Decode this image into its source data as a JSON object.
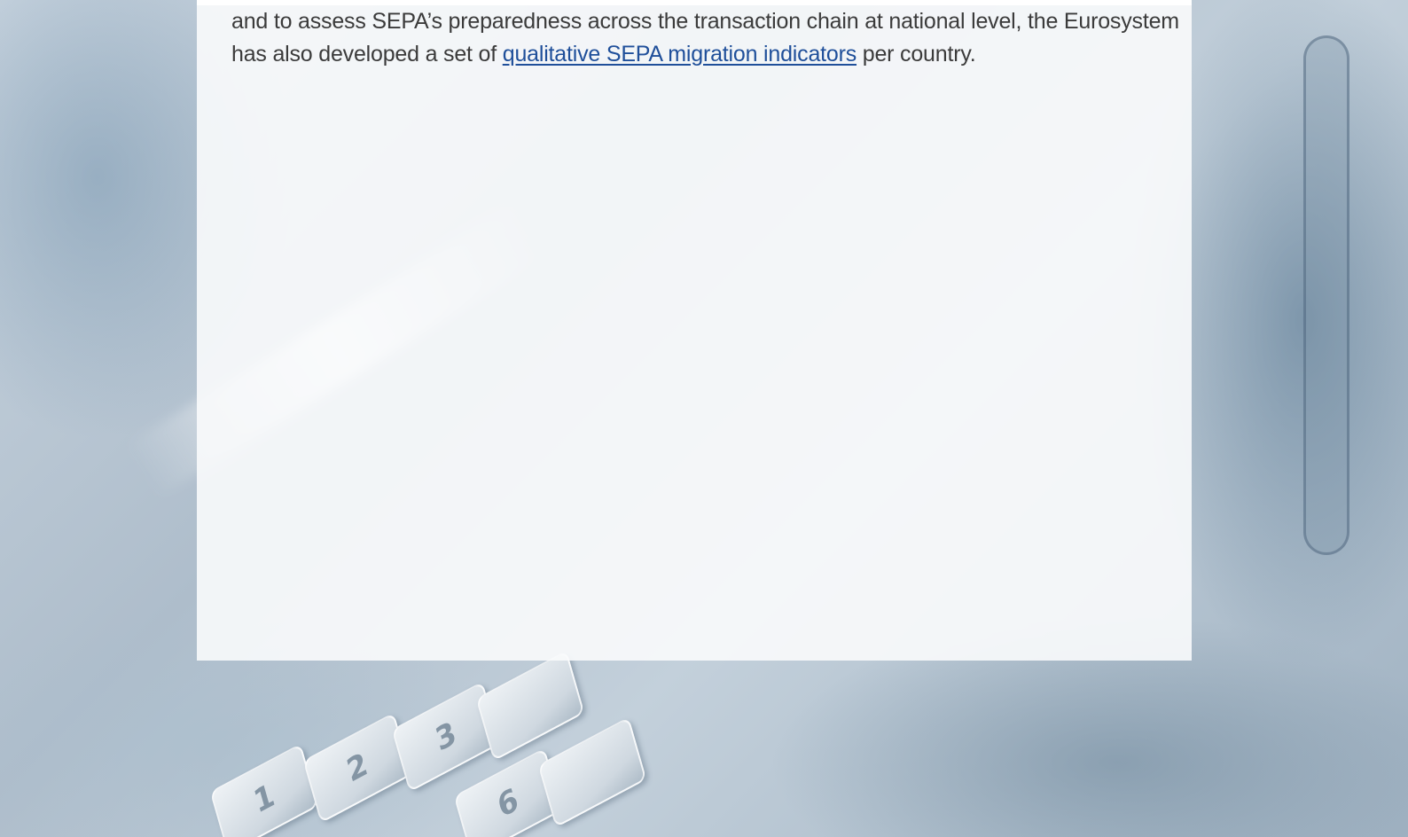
{
  "content": {
    "line1": "and to assess SEPA’s preparedness across the transaction chain at national level, the Eurosystem",
    "line2_before": "has also developed a set of ",
    "link_text": "qualitative SEPA migration indicators",
    "line2_after": " per country."
  },
  "background": {
    "keypad_keys": [
      "1",
      "2",
      "3",
      "6"
    ]
  }
}
